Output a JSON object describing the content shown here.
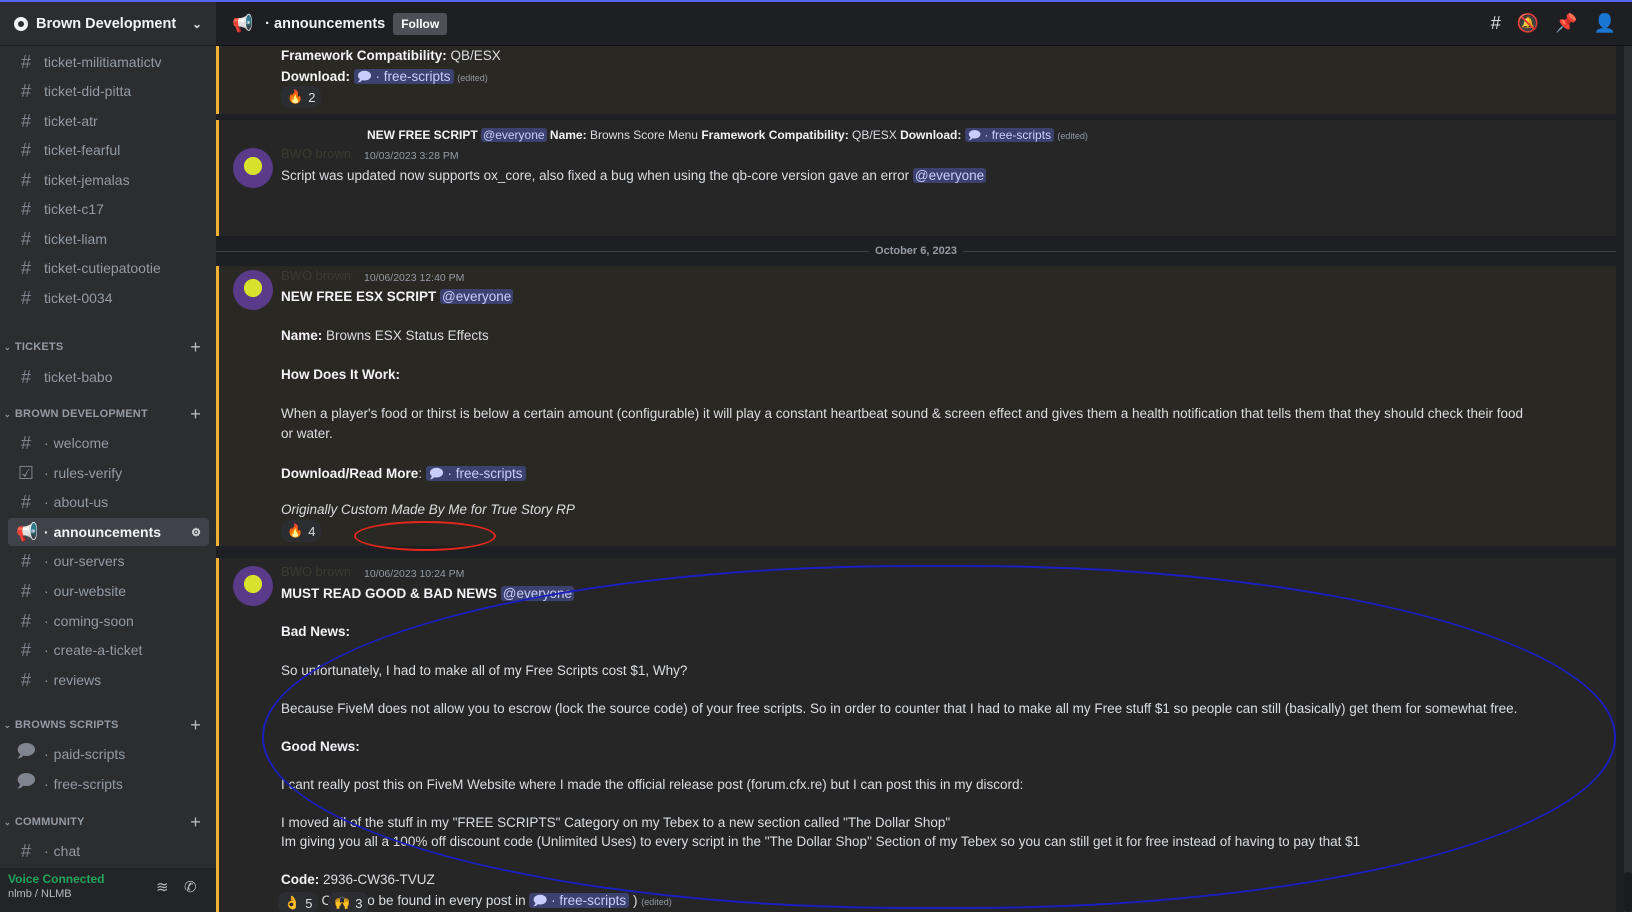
{
  "server": {
    "name": "Brown Development"
  },
  "header": {
    "channel_title": "announcements",
    "follow_label": "Follow"
  },
  "sidebar": {
    "tickets_top": [
      "ticket-militiamatictv",
      "ticket-did-pitta",
      "ticket-atr",
      "ticket-fearful",
      "ticket-jemalas",
      "ticket-c17",
      "ticket-liam",
      "ticket-cutiepatootie",
      "ticket-0034"
    ],
    "cat_tickets": "TICKETS",
    "ticket_babo": "ticket-babo",
    "cat_brown": "BROWN DEVELOPMENT",
    "brown": [
      "welcome",
      "rules-verify",
      "about-us",
      "announcements",
      "our-servers",
      "our-website",
      "coming-soon",
      "create-a-ticket",
      "reviews"
    ],
    "cat_scripts": "BROWNS SCRIPTS",
    "scripts": [
      "paid-scripts",
      "free-scripts"
    ],
    "cat_community": "COMMUNITY",
    "community": [
      "chat"
    ]
  },
  "voice": {
    "status": "Voice Connected",
    "server_line": "nlmb / NLMB"
  },
  "messages": {
    "m0": {
      "fc_label": "Framework Compatibility:",
      "fc_value": "QB/ESX",
      "dl_label": "Download:",
      "link": "free-scripts",
      "edited": "(edited)",
      "reaction_count": "2"
    },
    "m1": {
      "reply_title": "NEW FREE SCRIPT",
      "mention": "@everyone",
      "reply_name_label": "Name:",
      "reply_name": "Browns Score Menu",
      "reply_fc_label": "Framework Compatibility:",
      "reply_fc": "QB/ESX",
      "reply_dl_label": "Download:",
      "link": "free-scripts",
      "edited": "(edited)",
      "author": "BWO brown",
      "timestamp": "10/03/2023 3:28 PM",
      "text": "Script was updated now supports ox_core, also fixed a bug when using the qb-core version gave an error"
    },
    "divider_date": "October 6, 2023",
    "m2": {
      "author": "BWO brown",
      "timestamp": "10/06/2023 12:40 PM",
      "title": "NEW FREE ESX SCRIPT",
      "mention": "@everyone",
      "name_label": "Name:",
      "name_value": "Browns ESX Status Effects",
      "how_label": "How Does It Work:",
      "desc_line1": "When a player's food or thirst is below a certain amount (configurable) it will play a constant heartbeat sound & screen effect and gives them a health notification that tells them that they should check their food",
      "desc_line2": "or water.",
      "dl_label": "Download/Read More",
      "link": "free-scripts",
      "italic": "Originally Custom Made By Me for True Story RP",
      "reaction_count": "4"
    },
    "m3": {
      "author": "BWO brown",
      "timestamp": "10/06/2023 10:24 PM",
      "title": "MUST READ GOOD & BAD NEWS",
      "mention": "@everyone",
      "bad_label": "Bad News:",
      "bad_line": "So unfortunately, I had to make all of my Free Scripts cost $1, Why?",
      "because_line": "Because FiveM does not allow you to escrow (lock the source code) of your free scripts. So in order to counter that I had to make all my Free stuff $1 so people can still (basically) get them for somewhat free.",
      "good_label": "Good News:",
      "good_line": "I cant really post this on FiveM Website where I made the official release post (forum.cfx.re) but I can post this in my discord:",
      "moved_line": "I moved all of the stuff in my \"FREE SCRIPTS\" Category on my Tebex to a new section called \"The Dollar Shop\"",
      "giving_line": "Im giving you all a 100% off discount code (Unlimited Uses) to every script in the \"The Dollar Shop\" Section of my Tebex so you can still get it for free instead of having to pay that $1",
      "code_label": "Code:",
      "code_value": "2936-CW36-TVUZ",
      "found_line": "(Code Can also be found in every post in",
      "link": "free-scripts",
      "close_paren": ")",
      "edited": "(edited)",
      "reaction1_count": "5",
      "reaction2_count": "3"
    }
  }
}
